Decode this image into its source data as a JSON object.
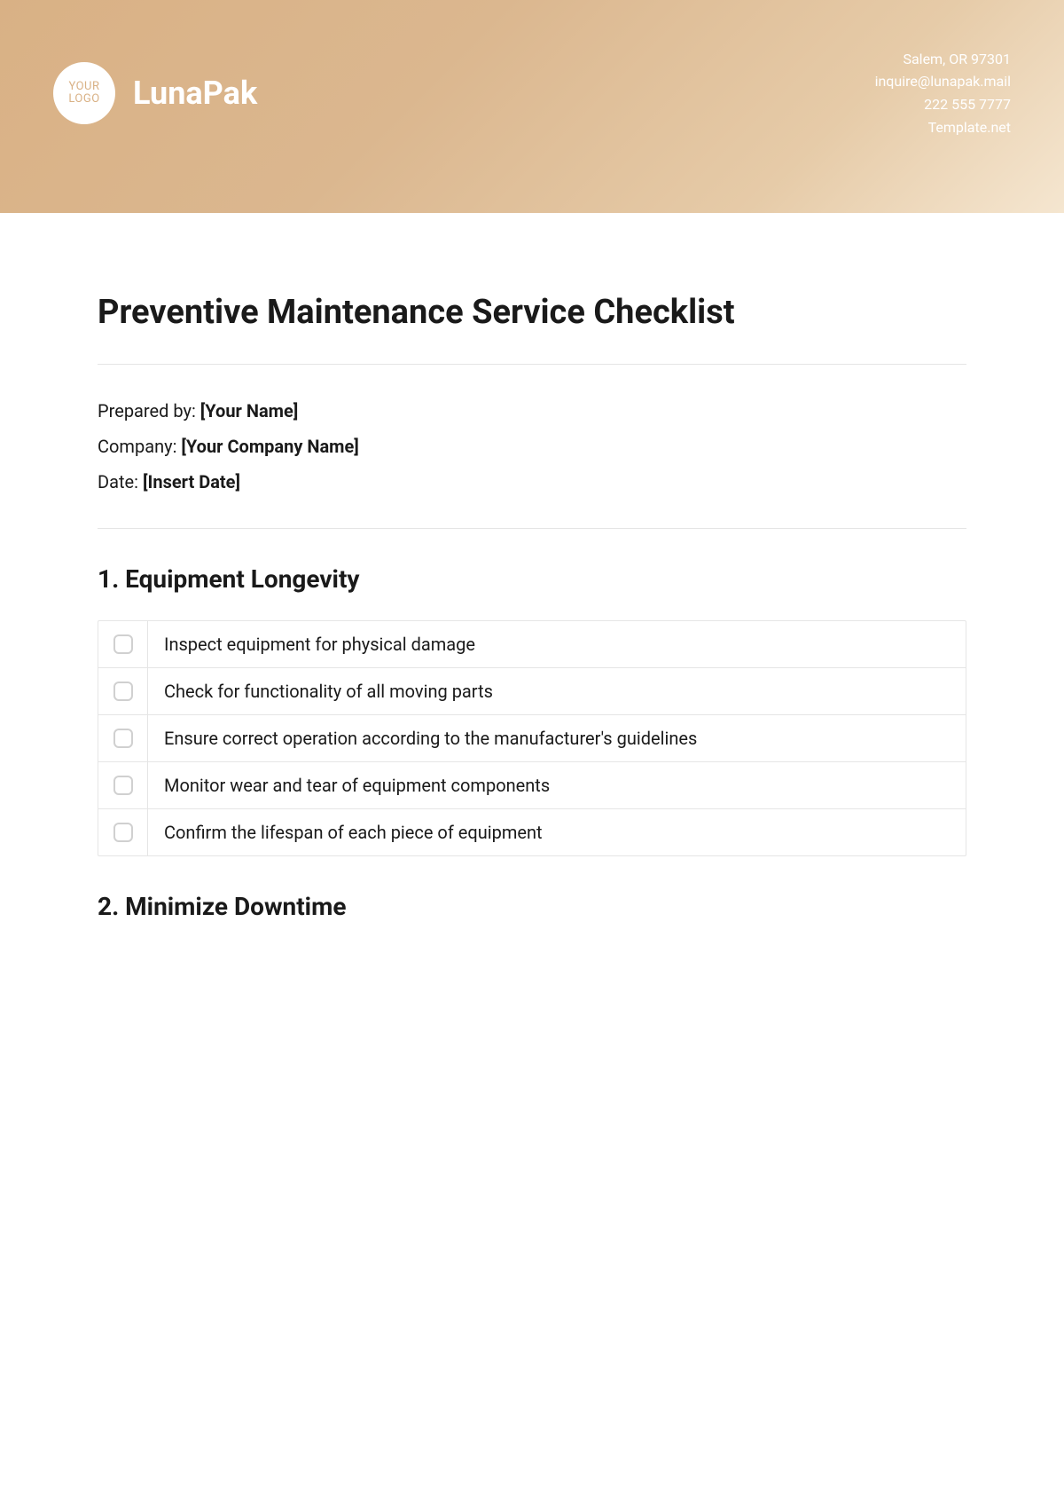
{
  "header": {
    "logo_text": "YOUR\nLOGO",
    "brand_name": "LunaPak",
    "contact": {
      "address": "Salem, OR 97301",
      "email": "inquire@lunapak.mail",
      "phone": "222 555 7777",
      "site": "Template.net"
    }
  },
  "document": {
    "title": "Preventive Maintenance Service Checklist",
    "meta": {
      "prepared_by_label": "Prepared by: ",
      "prepared_by_value": "[Your Name]",
      "company_label": "Company: ",
      "company_value": "[Your Company Name]",
      "date_label": "Date: ",
      "date_value": "[Insert Date]"
    },
    "sections": [
      {
        "heading": "1. Equipment Longevity",
        "items": [
          "Inspect equipment for physical damage",
          "Check for functionality of all moving parts",
          "Ensure correct operation according to the manufacturer's guidelines",
          "Monitor wear and tear of equipment components",
          "Confirm the lifespan of each piece of equipment"
        ]
      },
      {
        "heading": "2. Minimize Downtime",
        "items": []
      }
    ]
  }
}
